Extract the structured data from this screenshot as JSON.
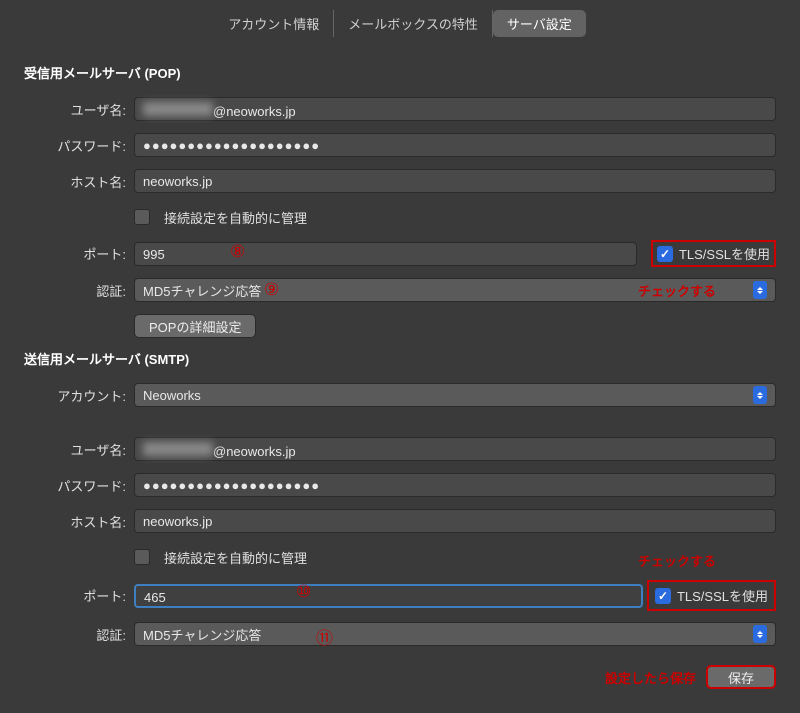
{
  "tabs": {
    "account_info": "アカウント情報",
    "mailbox": "メールボックスの特性",
    "server": "サーバ設定"
  },
  "incoming": {
    "title": "受信用メールサーバ (POP)",
    "user_label": "ユーザ名:",
    "user_suffix": "@neoworks.jp",
    "pass_label": "パスワード:",
    "pass_value": "●●●●●●●●●●●●●●●●●●●●",
    "host_label": "ホスト名:",
    "host_value": "neoworks.jp",
    "auto_label": "接続設定を自動的に管理",
    "port_label": "ポート:",
    "port_value": "995",
    "tls_label": "TLS/SSLを使用",
    "auth_label": "認証:",
    "auth_value": "MD5チャレンジ応答",
    "detail_btn": "POPの詳細設定"
  },
  "outgoing": {
    "title": "送信用メールサーバ (SMTP)",
    "account_label": "アカウント:",
    "account_value": "Neoworks",
    "user_label": "ユーザ名:",
    "user_suffix": "@neoworks.jp",
    "pass_label": "パスワード:",
    "pass_value": "●●●●●●●●●●●●●●●●●●●●",
    "host_label": "ホスト名:",
    "host_value": "neoworks.jp",
    "auto_label": "接続設定を自動的に管理",
    "port_label": "ポート:",
    "port_value": "465",
    "tls_label": "TLS/SSLを使用",
    "auth_label": "認証:",
    "auth_value": "MD5チャレンジ応答"
  },
  "annotations": {
    "m8": "⑧",
    "m9": "⑨",
    "m10": "⑩",
    "m11": "⑪",
    "check_it": "チェックする",
    "save_note": "設定したら保存"
  },
  "save_btn": "保存"
}
